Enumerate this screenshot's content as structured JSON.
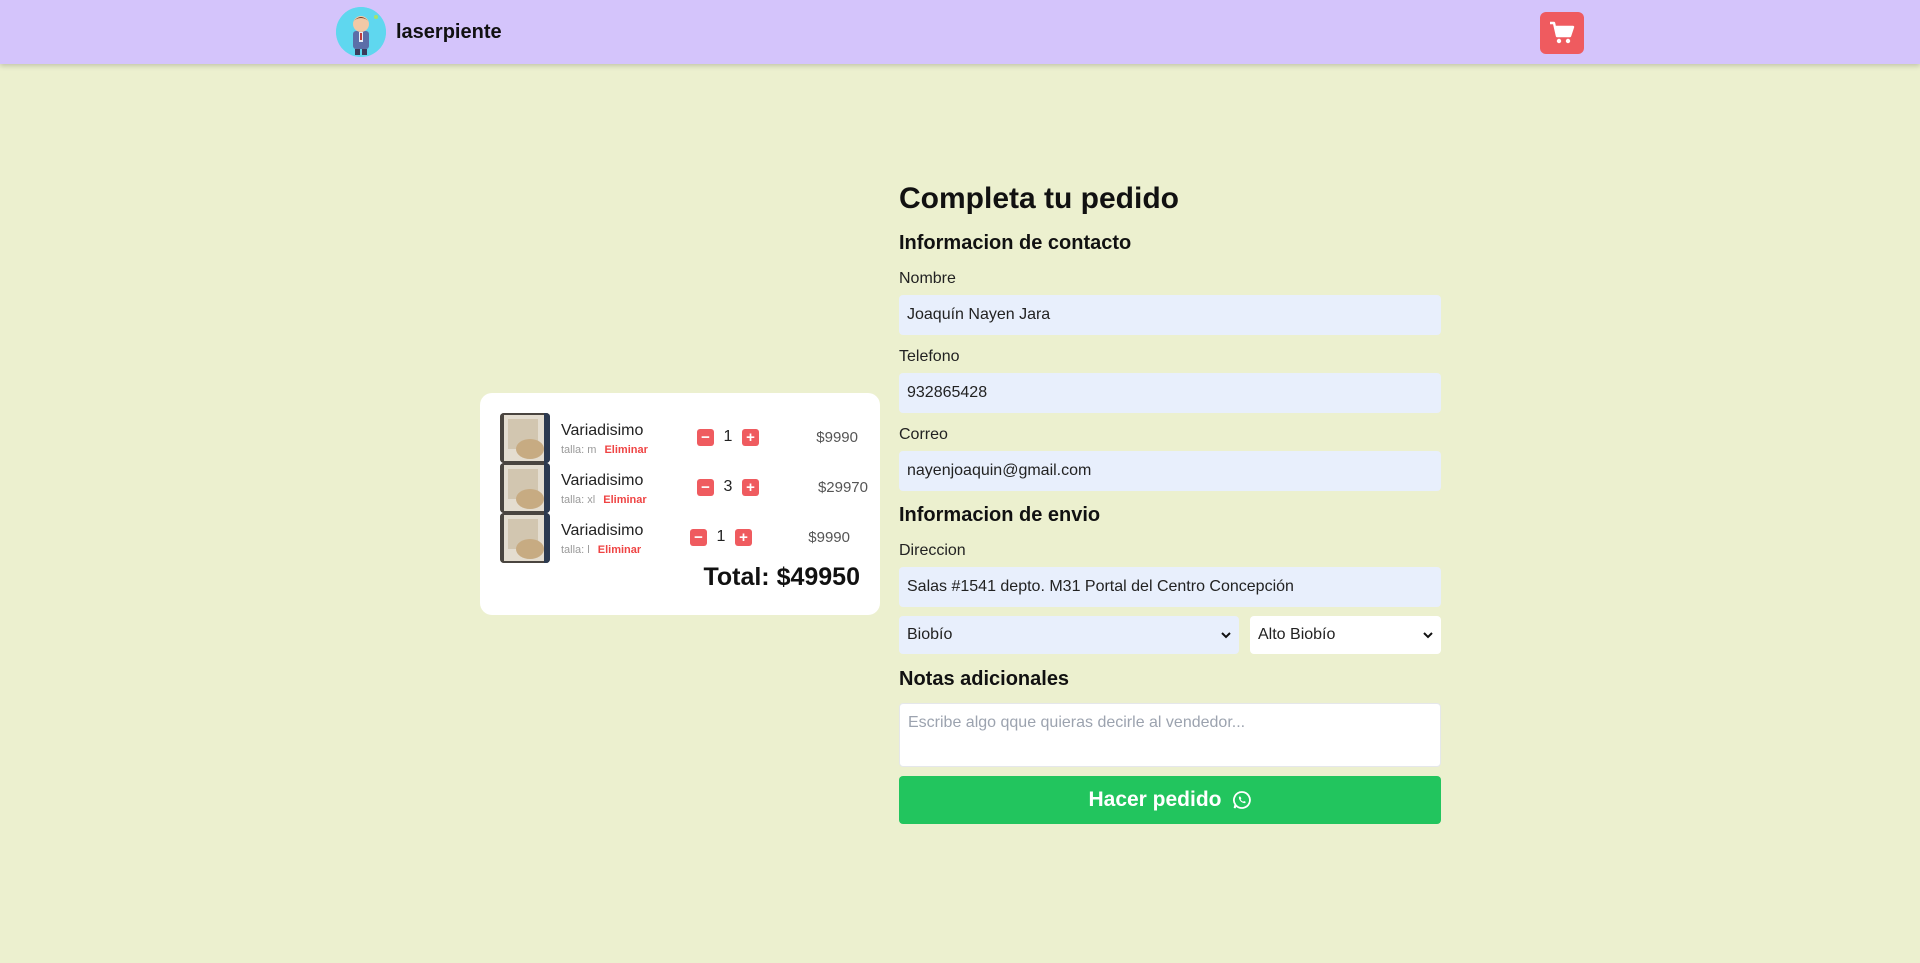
{
  "header": {
    "brand_name": "laserpiente"
  },
  "cart": {
    "items": [
      {
        "name": "Variadisimo",
        "size": "talla: m",
        "remove_label": "Eliminar",
        "qty": "1",
        "price": "$9990"
      },
      {
        "name": "Variadisimo",
        "size": "talla: xl",
        "remove_label": "Eliminar",
        "qty": "3",
        "price": "$29970"
      },
      {
        "name": "Variadisimo",
        "size": "talla: l",
        "remove_label": "Eliminar",
        "qty": "1",
        "price": "$9990"
      }
    ],
    "total": "Total: $49950",
    "minus_symbol": "−",
    "plus_symbol": "+"
  },
  "form": {
    "title": "Completa tu pedido",
    "contact_heading": "Informacion de contacto",
    "name_label": "Nombre",
    "name_value": "Joaquín Nayen Jara",
    "phone_label": "Telefono",
    "phone_value": "932865428",
    "email_label": "Correo",
    "email_value": "nayenjoaquin@gmail.com",
    "shipping_heading": "Informacion de envio",
    "address_label": "Direccion",
    "address_value": "Salas #1541 depto. M31 Portal del Centro Concepción",
    "region_value": "Biobío",
    "commune_value": "Alto Biobío",
    "notes_heading": "Notas adicionales",
    "notes_placeholder": "Escribe algo qque quieras decirle al vendedor...",
    "submit_label": "Hacer pedido"
  },
  "colors": {
    "background": "#ecf0cf",
    "header": "#d4c4fb",
    "accent_red": "#ef5b5f",
    "submit_green": "#22c55e",
    "input_bg": "#e8effc"
  },
  "icons": {
    "cart": "shopping-cart-icon",
    "submit": "whatsapp-icon",
    "select": "chevron-down-icon"
  }
}
